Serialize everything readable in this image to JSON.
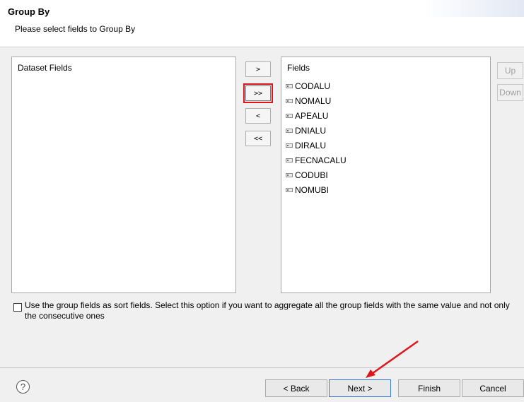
{
  "header": {
    "title": "Group By",
    "subtitle": "Please select fields to Group By"
  },
  "dataset_panel": {
    "header": "Dataset Fields"
  },
  "fields_panel": {
    "header": "Fields",
    "items": [
      "CODALU",
      "NOMALU",
      "APEALU",
      "DNIALU",
      "DIRALU",
      "FECNACALU",
      "CODUBI",
      "NOMUBI"
    ]
  },
  "move_buttons": {
    "add": ">",
    "add_all": ">>",
    "remove": "<",
    "remove_all": "<<"
  },
  "order_buttons": {
    "up": "Up",
    "down": "Down"
  },
  "sort_option": {
    "checked": false,
    "label": "Use the group fields as sort fields. Select this option if you want to aggregate all the group fields with the same value and not only the consecutive ones"
  },
  "footer": {
    "help": "?",
    "back": "< Back",
    "next": "Next >",
    "finish": "Finish",
    "cancel": "Cancel"
  },
  "colors": {
    "highlight": "#e0151b",
    "focus_border": "#3b7bd4"
  }
}
